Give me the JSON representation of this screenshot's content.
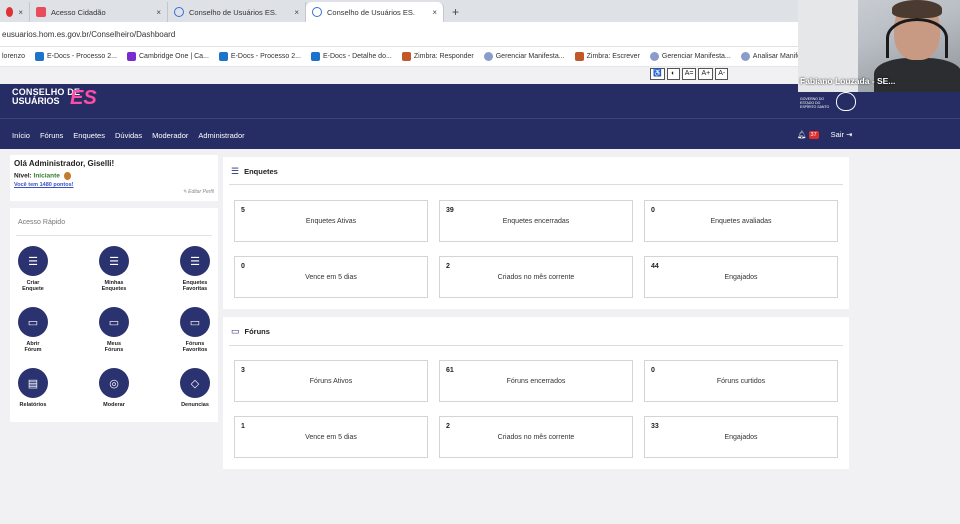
{
  "browser": {
    "tabs": [
      {
        "label": "",
        "close": "×"
      },
      {
        "label": "Acesso Cidadão",
        "close": "×"
      },
      {
        "label": "Conselho de Usuários ES.",
        "close": "×"
      },
      {
        "label": "Conselho de Usuários ES.",
        "close": "×"
      }
    ],
    "new_tab": "+",
    "url": "eusuarios.hom.es.gov.br/Conselheiro/Dashboard",
    "bookmarks": [
      "lorenzo",
      "E-Docs - Processo 2...",
      "Cambridge One | Ca...",
      "E-Docs - Processo 2...",
      "E-Docs - Detalhe do...",
      "Zimbra: Responder",
      "Gerenciar Manifesta...",
      "Zimbra: Escrever",
      "Gerenciar Manifesta...",
      "Analisar Manifestaç..."
    ]
  },
  "accessibility": [
    "♿",
    "◐",
    "A=",
    "A+",
    "A-"
  ],
  "webcam": {
    "name": "Fabiano Louzada - SE..."
  },
  "logo": {
    "line1": "CONSELHO DE",
    "line2": "USUÁRIOS",
    "es": "ES"
  },
  "gov_logo": {
    "text": "GOVERNO DO ESTADO DO ESPÍRITO SANTO"
  },
  "nav": {
    "items": [
      "Início",
      "Fóruns",
      "Enquetes",
      "Dúvidas",
      "Moderador",
      "Administrador"
    ],
    "notifications": "37",
    "logout": "Sair"
  },
  "user": {
    "greeting": "Olá Administrador, Giselli!",
    "level_label": "Nível:",
    "level_value": "Iniciante",
    "points": "Você tem 1480 pontos!",
    "edit": "Editar Perfil"
  },
  "quick_access": {
    "title": "Acesso Rápido",
    "items": [
      {
        "label1": "Criar",
        "label2": "Enquete"
      },
      {
        "label1": "Minhas",
        "label2": "Enquetes"
      },
      {
        "label1": "Enquetes",
        "label2": "Favoritas"
      },
      {
        "label1": "Abrir",
        "label2": "Fórum"
      },
      {
        "label1": "Meus",
        "label2": "Fóruns"
      },
      {
        "label1": "Fóruns",
        "label2": "Favoritos"
      },
      {
        "label1": "Relatórios",
        "label2": ""
      },
      {
        "label1": "Moderar",
        "label2": ""
      },
      {
        "label1": "Denuncias",
        "label2": ""
      }
    ]
  },
  "enquetes": {
    "title": "Enquetes",
    "stats": [
      {
        "value": "5",
        "label": "Enquetes Ativas"
      },
      {
        "value": "39",
        "label": "Enquetes encerradas"
      },
      {
        "value": "0",
        "label": "Enquetes avaliadas"
      },
      {
        "value": "0",
        "label": "Vence em 5 dias"
      },
      {
        "value": "2",
        "label": "Criados no mês corrente"
      },
      {
        "value": "44",
        "label": "Engajados"
      }
    ]
  },
  "foruns": {
    "title": "Fóruns",
    "stats": [
      {
        "value": "3",
        "label": "Fóruns Ativos"
      },
      {
        "value": "61",
        "label": "Fóruns encerrados"
      },
      {
        "value": "0",
        "label": "Fóruns curtidos"
      },
      {
        "value": "1",
        "label": "Vence em 5 dias"
      },
      {
        "value": "2",
        "label": "Criados no mês corrente"
      },
      {
        "value": "33",
        "label": "Engajados"
      }
    ]
  }
}
